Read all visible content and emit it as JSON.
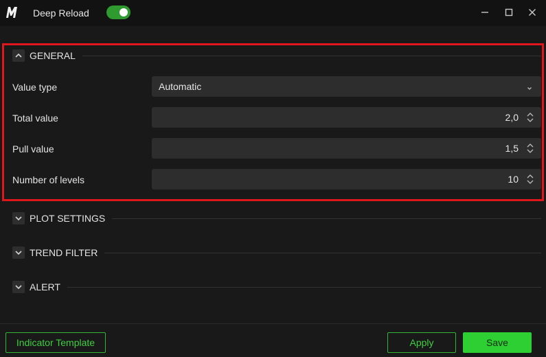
{
  "window": {
    "title": "Deep Reload",
    "toggle_on": true,
    "accent": "#2ecf33",
    "highlight_color": "#e0181e"
  },
  "sections": {
    "general": {
      "label": "GENERAL",
      "expanded": true,
      "fields": {
        "value_type": {
          "label": "Value type",
          "value": "Automatic"
        },
        "total_value": {
          "label": "Total value",
          "value": "2,0"
        },
        "pull_value": {
          "label": "Pull value",
          "value": "1,5"
        },
        "levels": {
          "label": "Number of levels",
          "value": "10"
        }
      }
    },
    "plot_settings": {
      "label": "PLOT SETTINGS",
      "expanded": false
    },
    "trend_filter": {
      "label": "TREND FILTER",
      "expanded": false
    },
    "alert": {
      "label": "ALERT",
      "expanded": false
    }
  },
  "footer": {
    "template_label": "Indicator Template",
    "apply_label": "Apply",
    "save_label": "Save"
  }
}
